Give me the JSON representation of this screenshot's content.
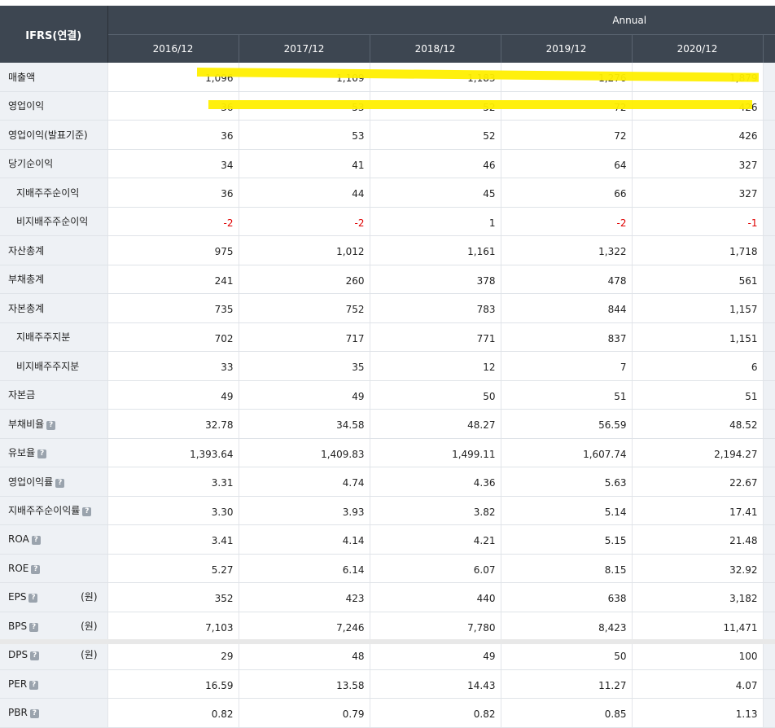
{
  "header": {
    "ifrs_label": "IFRS(연결)",
    "period_group": "Annual",
    "years": [
      "2016/12",
      "2017/12",
      "2018/12",
      "2019/12",
      "2020/12"
    ]
  },
  "rows": [
    {
      "label": "매출액",
      "values": [
        "1,096",
        "1,109",
        "1,183",
        "1,276",
        "1,879"
      ]
    },
    {
      "label": "영업이익",
      "values": [
        "36",
        "53",
        "52",
        "72",
        "426"
      ]
    },
    {
      "label": "영업이익(발표기준)",
      "values": [
        "36",
        "53",
        "52",
        "72",
        "426"
      ]
    },
    {
      "label": "당기순이익",
      "values": [
        "34",
        "41",
        "46",
        "64",
        "327"
      ]
    },
    {
      "label": "지배주주순이익",
      "sub": true,
      "values": [
        "36",
        "44",
        "45",
        "66",
        "327"
      ]
    },
    {
      "label": "비지배주주순이익",
      "sub": true,
      "values": [
        "-2",
        "-2",
        "1",
        "-2",
        "-1"
      ]
    },
    {
      "label": "자산총계",
      "values": [
        "975",
        "1,012",
        "1,161",
        "1,322",
        "1,718"
      ]
    },
    {
      "label": "부채총계",
      "values": [
        "241",
        "260",
        "378",
        "478",
        "561"
      ]
    },
    {
      "label": "자본총계",
      "values": [
        "735",
        "752",
        "783",
        "844",
        "1,157"
      ]
    },
    {
      "label": "지배주주지분",
      "sub": true,
      "values": [
        "702",
        "717",
        "771",
        "837",
        "1,151"
      ]
    },
    {
      "label": "비지배주주지분",
      "sub": true,
      "values": [
        "33",
        "35",
        "12",
        "7",
        "6"
      ]
    },
    {
      "label": "자본금",
      "values": [
        "49",
        "49",
        "50",
        "51",
        "51"
      ]
    },
    {
      "label": "부채비율",
      "help": true,
      "values": [
        "32.78",
        "34.58",
        "48.27",
        "56.59",
        "48.52"
      ]
    },
    {
      "label": "유보율",
      "help": true,
      "values": [
        "1,393.64",
        "1,409.83",
        "1,499.11",
        "1,607.74",
        "2,194.27"
      ]
    },
    {
      "label": "영업이익률",
      "help": true,
      "values": [
        "3.31",
        "4.74",
        "4.36",
        "5.63",
        "22.67"
      ]
    },
    {
      "label": "지배주주순이익률",
      "help": true,
      "values": [
        "3.30",
        "3.93",
        "3.82",
        "5.14",
        "17.41"
      ]
    },
    {
      "label": "ROA",
      "help": true,
      "values": [
        "3.41",
        "4.14",
        "4.21",
        "5.15",
        "21.48"
      ]
    },
    {
      "label": "ROE",
      "help": true,
      "values": [
        "5.27",
        "6.14",
        "6.07",
        "8.15",
        "32.92"
      ]
    },
    {
      "label": "EPS",
      "help": true,
      "unit": "(원)",
      "values": [
        "352",
        "423",
        "440",
        "638",
        "3,182"
      ]
    },
    {
      "label": "BPS",
      "help": true,
      "unit": "(원)",
      "values": [
        "7,103",
        "7,246",
        "7,780",
        "8,423",
        "11,471"
      ]
    },
    {
      "label": "DPS",
      "help": true,
      "unit": "(원)",
      "values": [
        "29",
        "48",
        "49",
        "50",
        "100"
      ]
    },
    {
      "label": "PER",
      "help": true,
      "values": [
        "16.59",
        "13.58",
        "14.43",
        "11.27",
        "4.07"
      ]
    },
    {
      "label": "PBR",
      "help": true,
      "values": [
        "0.82",
        "0.79",
        "0.82",
        "0.85",
        "1.13"
      ]
    }
  ],
  "help_icon_glyph": "?",
  "colors": {
    "header_bg": "#3d4651",
    "label_bg": "#eef1f5",
    "negative": "#e00000",
    "highlight": "#ffef00"
  }
}
